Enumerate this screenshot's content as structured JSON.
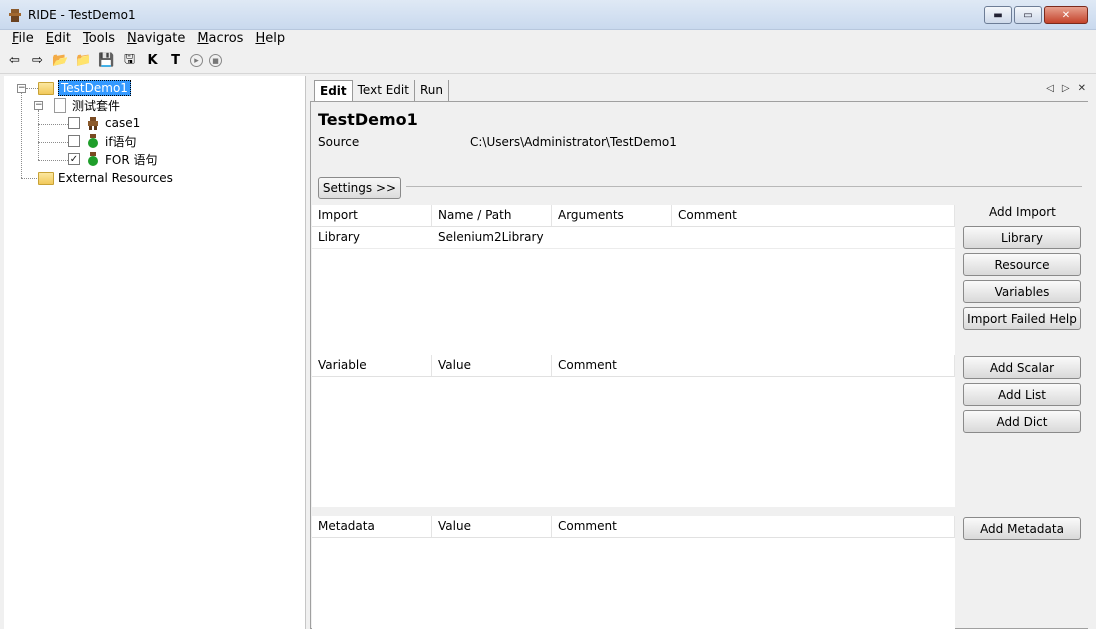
{
  "window": {
    "title": "RIDE - TestDemo1",
    "minimize": "▬",
    "maximize": "▭",
    "close": "✕"
  },
  "menu": [
    {
      "label": "File",
      "mnemonic": "F",
      "rest": "ile"
    },
    {
      "label": "Edit",
      "mnemonic": "E",
      "rest": "dit"
    },
    {
      "label": "Tools",
      "mnemonic": "T",
      "rest": "ools"
    },
    {
      "label": "Navigate",
      "mnemonic": "N",
      "rest": "avigate"
    },
    {
      "label": "Macros",
      "mnemonic": "M",
      "rest": "acros"
    },
    {
      "label": "Help",
      "mnemonic": "H",
      "rest": "elp"
    }
  ],
  "toolbar": {
    "back": "⇦",
    "forward": "⇨",
    "open_dir": "📂",
    "open": "📁",
    "save": "💾",
    "save_all": "🖫",
    "search_keyword": "K",
    "search_tests": "T",
    "run": "▸",
    "stop": "■"
  },
  "tree": {
    "root": "TestDemo1",
    "suite": "测试套件",
    "cases": [
      {
        "label": "case1",
        "checked": false
      },
      {
        "label": "if语句",
        "checked": false
      },
      {
        "label": "FOR 语句",
        "checked": true
      }
    ],
    "external": "External Resources"
  },
  "tabs": [
    "Edit",
    "Text Edit",
    "Run"
  ],
  "tab_nav": {
    "left": "◁",
    "right": "▷",
    "close": "✕"
  },
  "suite_view": {
    "title": "TestDemo1",
    "source_label": "Source",
    "source_value": "C:\\Users\\Administrator\\TestDemo1",
    "settings_button": "Settings >>",
    "import": {
      "headers": [
        "Import",
        "Name / Path",
        "Arguments",
        "Comment"
      ],
      "rows": [
        [
          "Library",
          "Selenium2Library",
          "",
          ""
        ]
      ]
    },
    "variables": {
      "headers": [
        "Variable",
        "Value",
        "Comment"
      ]
    },
    "metadata": {
      "headers": [
        "Metadata",
        "Value",
        "Comment"
      ]
    },
    "side": {
      "add_import_label": "Add Import",
      "library": "Library",
      "resource": "Resource",
      "variables": "Variables",
      "import_failed_help": "Import Failed Help",
      "add_scalar": "Add Scalar",
      "add_list": "Add List",
      "add_dict": "Add Dict",
      "add_metadata": "Add Metadata"
    }
  },
  "colors": {
    "selection": "#3399ff",
    "titlebar": "#c9d9ee",
    "close_button": "#c4432b"
  }
}
